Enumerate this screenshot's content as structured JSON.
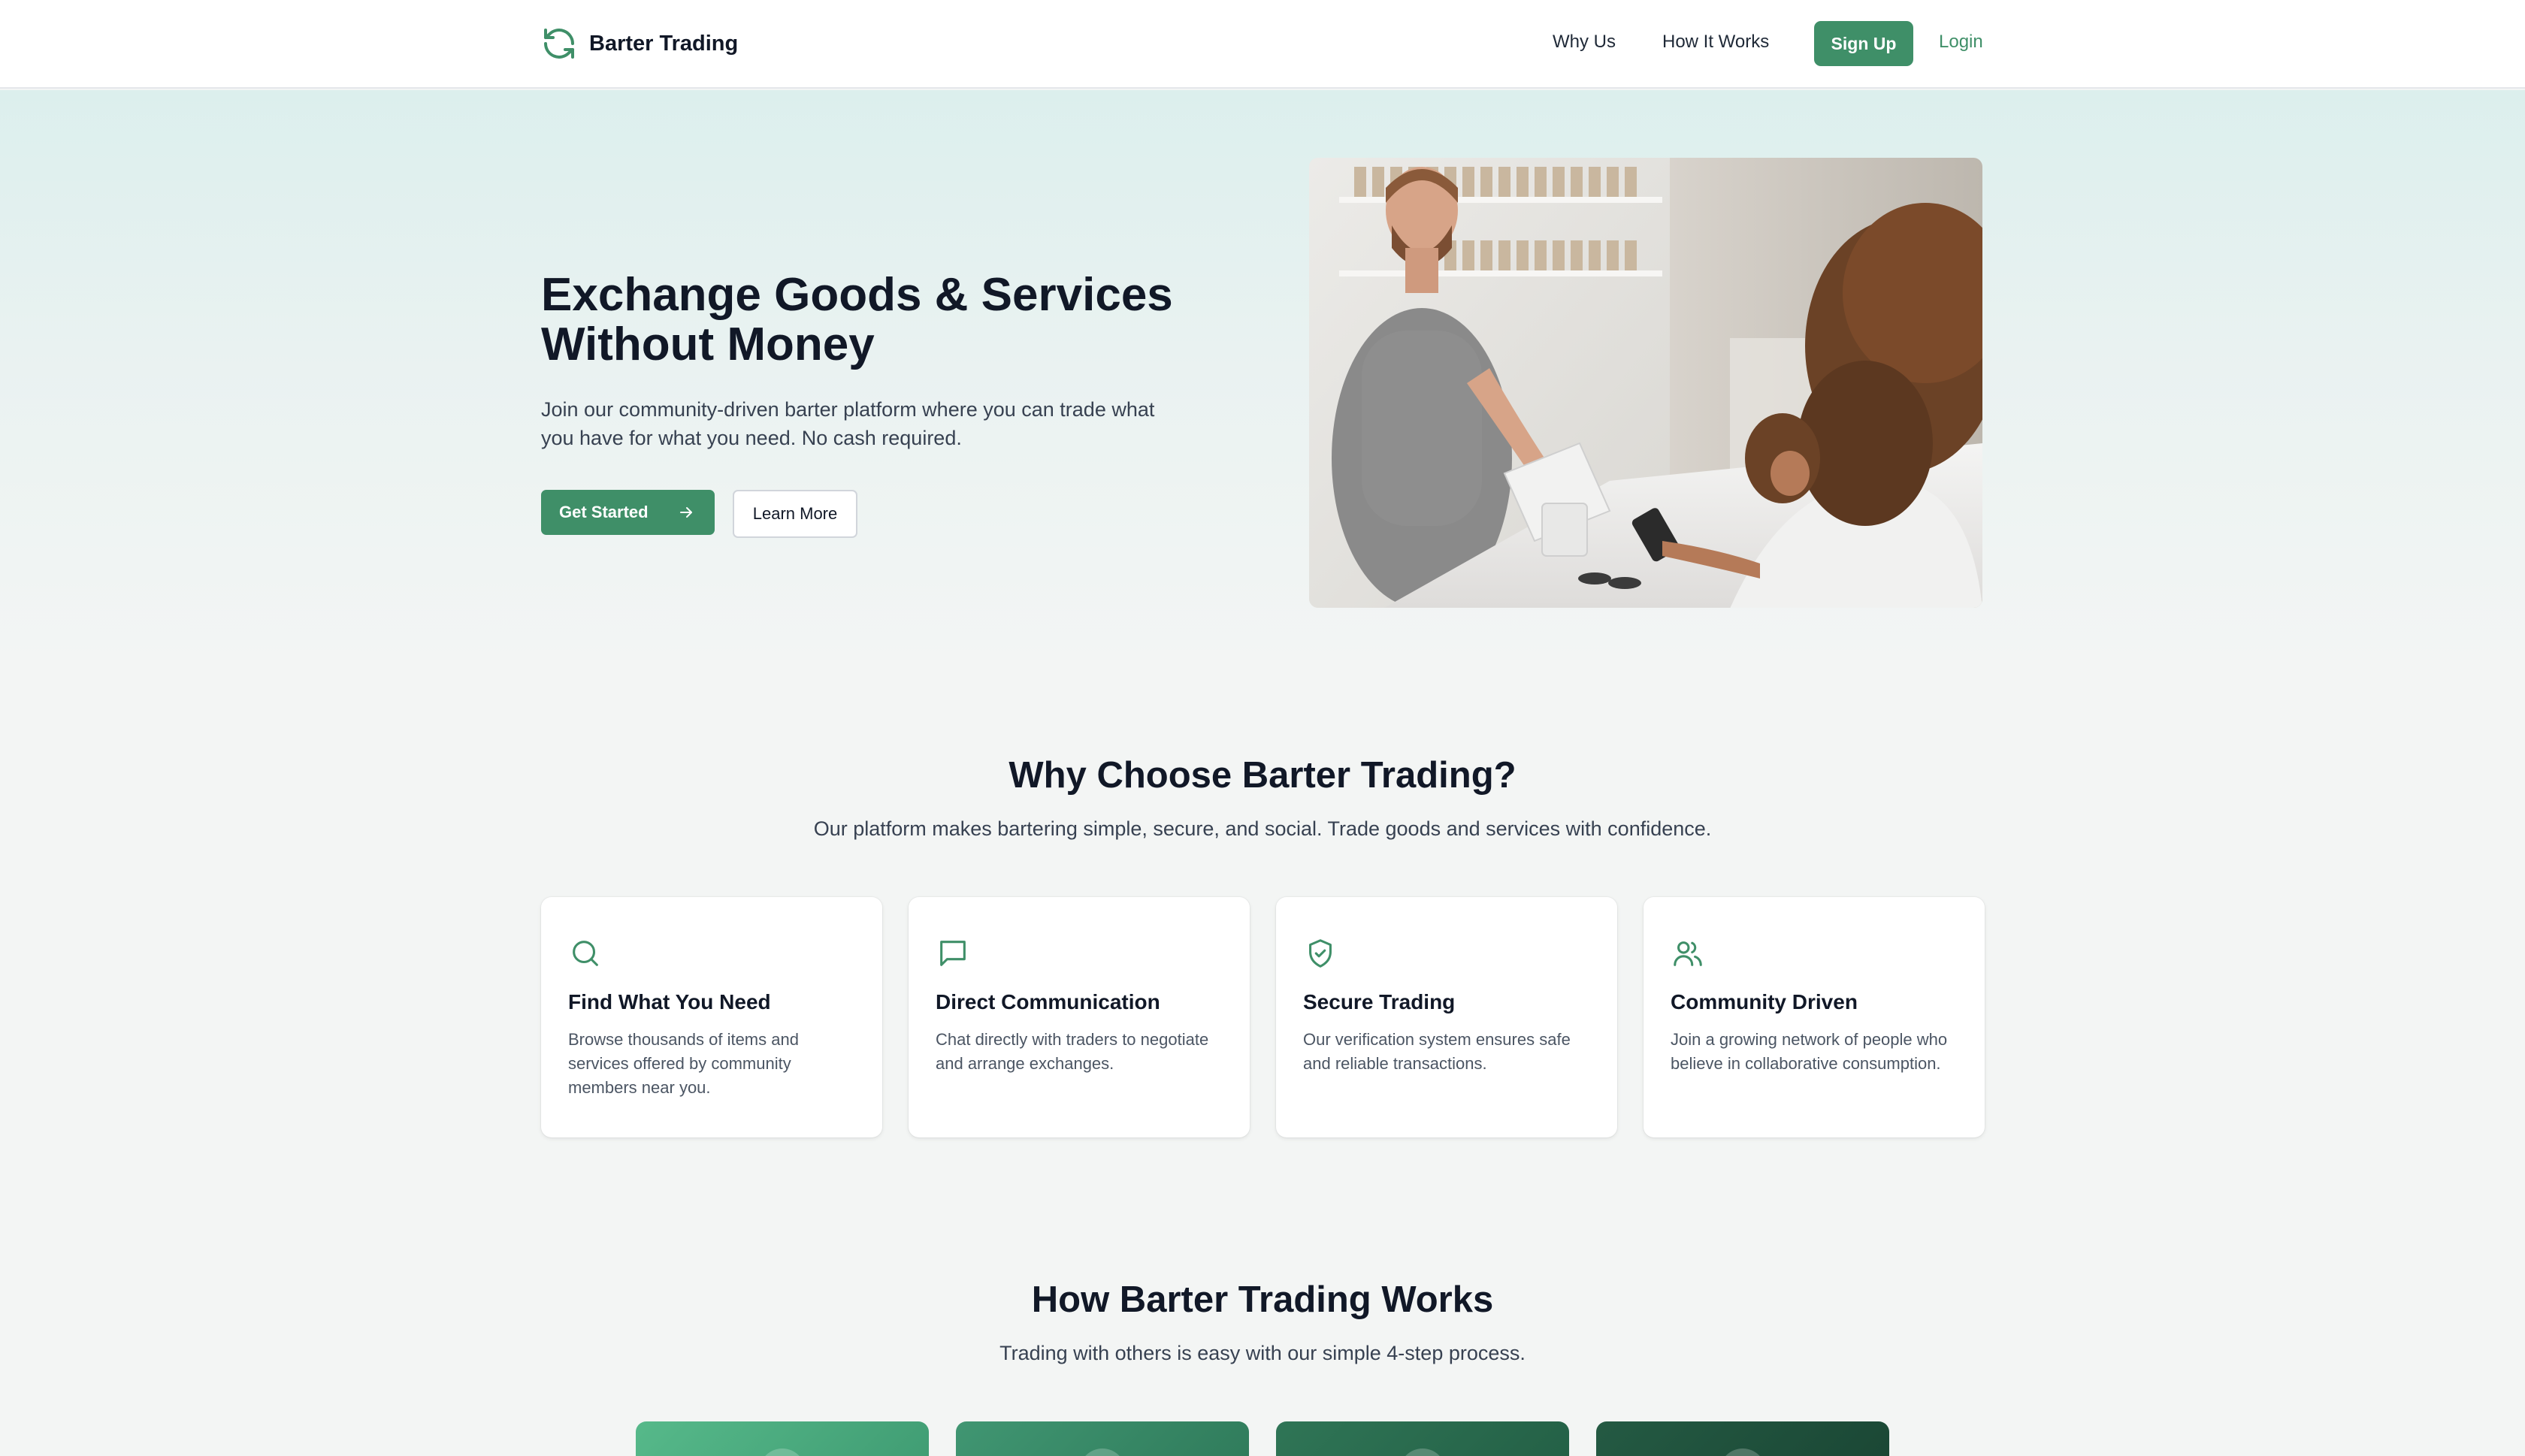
{
  "colors": {
    "accent": "#3f8f68",
    "text_dark": "#111827",
    "text_body": "#374151",
    "page_bg": "#f3f5f4",
    "hero_gradient_top": "#dcefed"
  },
  "nav": {
    "brand_name": "Barter Trading",
    "brand_icon": "refresh-cycle-icon",
    "links": [
      "Why Us",
      "How It Works"
    ],
    "signup_label": "Sign Up",
    "login_label": "Login"
  },
  "hero": {
    "title": "Exchange Goods & Services Without Money",
    "description": "Join our community-driven barter platform where you can trade what you have for what you need. No cash required.",
    "primary_button": "Get Started",
    "primary_button_icon": "arrow-right-icon",
    "secondary_button": "Learn More",
    "image_subject": "photo"
  },
  "why": {
    "title": "Why Choose Barter Trading?",
    "subtitle": "Our platform makes bartering simple, secure, and social. Trade goods and services with confidence.",
    "features": [
      {
        "icon": "search-icon",
        "title": "Find What You Need",
        "description": "Browse thousands of items and services offered by community members near you."
      },
      {
        "icon": "chat-bubble-icon",
        "title": "Direct Communication",
        "description": "Chat directly with traders to negotiate and arrange exchanges."
      },
      {
        "icon": "shield-check-icon",
        "title": "Secure Trading",
        "description": "Our verification system ensures safe and reliable transactions."
      },
      {
        "icon": "users-icon",
        "title": "Community Driven",
        "description": "Join a growing network of people who believe in collaborative consumption."
      }
    ]
  },
  "how": {
    "title": "How Barter Trading Works",
    "subtitle": "Trading with others is easy with our simple 4-step process.",
    "step_count": 4
  }
}
